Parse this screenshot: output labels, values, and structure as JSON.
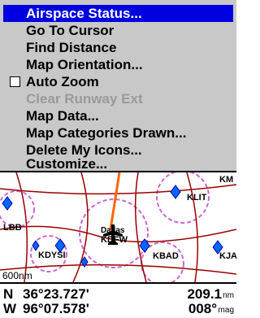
{
  "menu": {
    "items": [
      {
        "label": "Airspace Status..."
      },
      {
        "label": "Go To Cursor"
      },
      {
        "label": "Find Distance"
      },
      {
        "label": "Map Orientation..."
      },
      {
        "label": "Auto Zoom"
      },
      {
        "label": "Clear Runway Ext"
      },
      {
        "label": "Map Data..."
      },
      {
        "label": "Map Categories Drawn..."
      },
      {
        "label": "Delete My Icons..."
      },
      {
        "label": "Customize..."
      }
    ],
    "selected": "Airspace Status...",
    "auto_zoom_checked": false
  },
  "map": {
    "labels": {
      "klit": "KLIT",
      "km": "KM",
      "lbb": "LBB",
      "dfw_city": "Dallas",
      "kdfw": "KDFW",
      "kdys": "KDYSI",
      "kbad": "KBAD",
      "kja": "KJA"
    },
    "scale": "600nm"
  },
  "status": {
    "lat_hem": "N",
    "lat": "36°23.727'",
    "lon_hem": "W",
    "lon": "96°07.578'",
    "distance_value": "209.1",
    "distance_unit": "nm",
    "bearing_value": "008°",
    "bearing_unit": "mag"
  },
  "colors": {
    "menu_bg": "#c8c8c8",
    "highlight": "#0000e0",
    "disabled": "#9a9a9a",
    "route": "#ff6600",
    "roads": "#990000",
    "airspace": "#cc66cc",
    "airport": "#0066ff"
  }
}
